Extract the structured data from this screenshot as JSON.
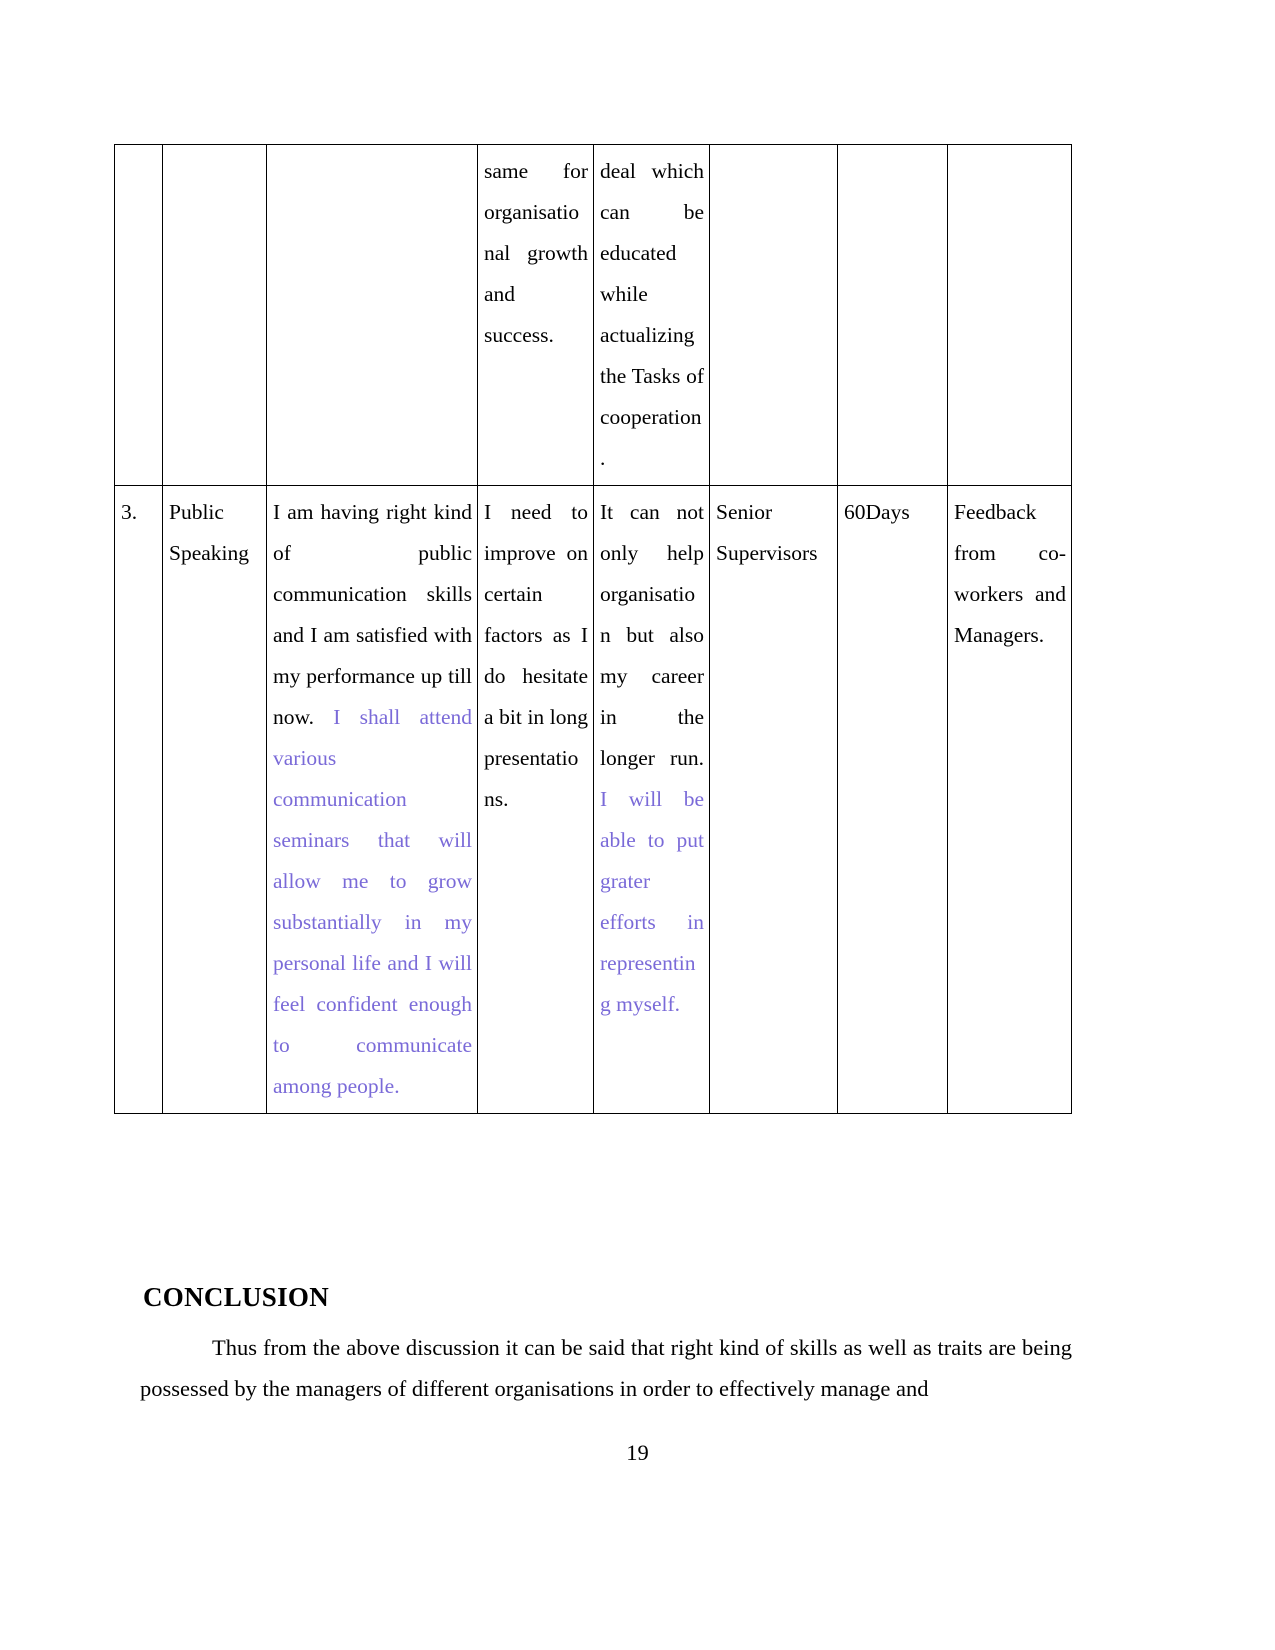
{
  "document": {
    "page_number": "19",
    "accent_color": "#7a6ad8",
    "table": {
      "columns": 8,
      "rows": [
        {
          "id": "row-continued",
          "cells": [
            {
              "name": "serial-number",
              "text": ""
            },
            {
              "name": "skill-name",
              "text": ""
            },
            {
              "name": "current-proficiency",
              "text": ""
            },
            {
              "name": "development-need",
              "runs": [
                {
                  "text": "same for organisational growth and success.",
                  "color": "black"
                }
              ]
            },
            {
              "name": "benefit",
              "runs": [
                {
                  "text": "deal which can be educated while actualizing the Tasks of cooperation.",
                  "color": "black"
                }
              ]
            },
            {
              "name": "resources",
              "text": ""
            },
            {
              "name": "timeframe",
              "text": ""
            },
            {
              "name": "evidence",
              "text": ""
            }
          ]
        },
        {
          "id": "row-3",
          "cells": [
            {
              "name": "serial-number",
              "text": "3."
            },
            {
              "name": "skill-name",
              "text": "Public Speaking"
            },
            {
              "name": "current-proficiency",
              "runs": [
                {
                  "text": "I am having right kind of public communication skills and I am satisfied with my performance up till now. ",
                  "color": "black"
                },
                {
                  "text": "I shall attend various communication seminars that will allow me to grow substantially in my personal life and I will feel confident enough to communicate among people.",
                  "color": "purple"
                }
              ]
            },
            {
              "name": "development-need",
              "runs": [
                {
                  "text": "I need to improve on certain factors as I do hesitate a bit in long presentations.",
                  "color": "black"
                }
              ]
            },
            {
              "name": "benefit",
              "runs": [
                {
                  "text": "It can not only help organisation but also my career in the longer run. ",
                  "color": "black"
                },
                {
                  "text": "I will be able to put grater efforts in representing myself.",
                  "color": "purple"
                }
              ]
            },
            {
              "name": "resources",
              "text": "Senior Supervisors"
            },
            {
              "name": "timeframe",
              "text": "60Days"
            },
            {
              "name": "evidence",
              "text": "Feedback from co-workers and Managers."
            }
          ]
        }
      ]
    },
    "conclusion": {
      "heading": "CONCLUSION",
      "paragraph": "Thus from the above discussion it can be said that right kind of skills as well as traits are being possessed by the managers of different organisations in order to effectively manage and"
    }
  }
}
